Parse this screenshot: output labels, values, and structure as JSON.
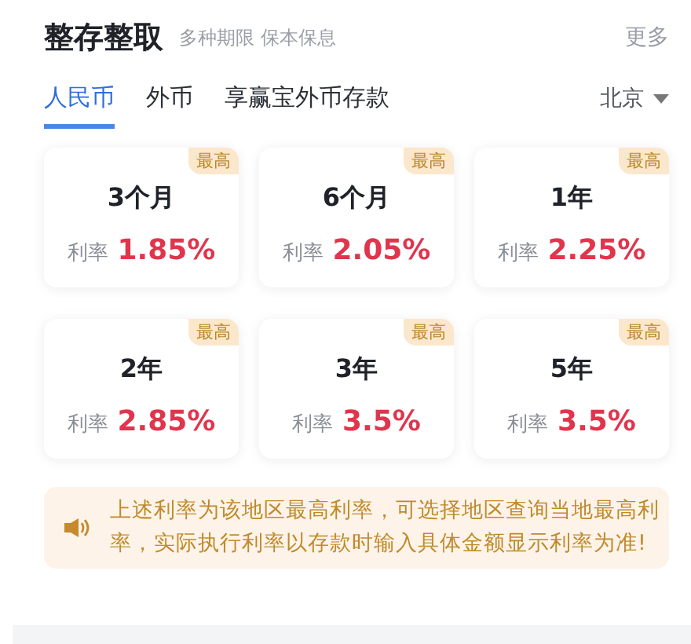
{
  "header": {
    "title": "整存整取",
    "subtitle": "多种期限 保本保息",
    "more": "更多"
  },
  "tabs": [
    {
      "label": "人民币",
      "selected": true
    },
    {
      "label": "外币",
      "selected": false
    },
    {
      "label": "享赢宝外币存款",
      "selected": false
    }
  ],
  "region": "北京",
  "products": [
    {
      "term": "3个月",
      "rate_label": "利率",
      "rate": "1.85%",
      "badge": "最高"
    },
    {
      "term": "6个月",
      "rate_label": "利率",
      "rate": "2.05%",
      "badge": "最高"
    },
    {
      "term": "1年",
      "rate_label": "利率",
      "rate": "2.25%",
      "badge": "最高"
    },
    {
      "term": "2年",
      "rate_label": "利率",
      "rate": "2.85%",
      "badge": "最高"
    },
    {
      "term": "3年",
      "rate_label": "利率",
      "rate": "3.5%",
      "badge": "最高"
    },
    {
      "term": "5年",
      "rate_label": "利率",
      "rate": "3.5%",
      "badge": "最高"
    }
  ],
  "notice": "上述利率为该地区最高利率，可选择地区查询当地最高利率，实际执行利率以存款时输入具体金额显示利率为准!"
}
